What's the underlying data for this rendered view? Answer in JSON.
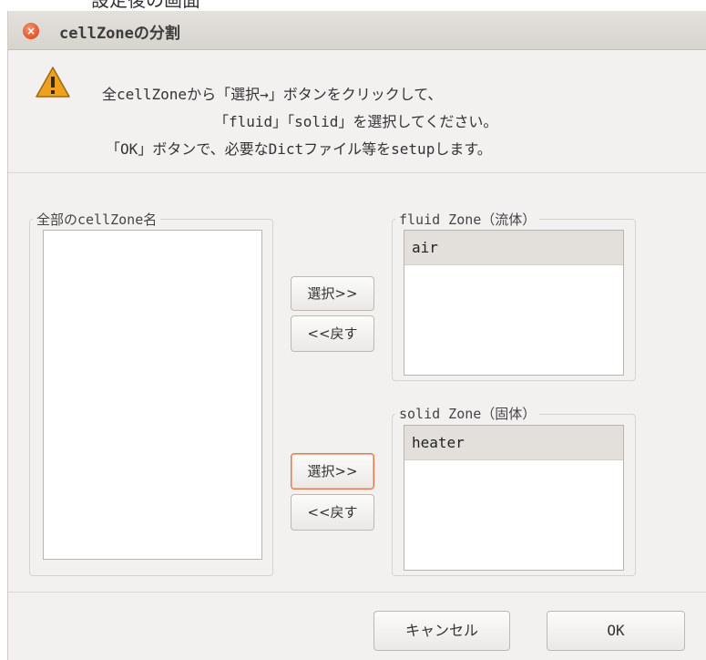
{
  "caption": "設定後の画面",
  "window": {
    "title": "cellZoneの分割"
  },
  "message": {
    "line1": "全cellZoneから「選択→」ボタンをクリックして、",
    "line2": "「fluid」「solid」を選択してください。",
    "line3": "「OK」ボタンで、必要なDictファイル等をsetupします。"
  },
  "all_zones": {
    "title": "全部のcellZone名",
    "items": []
  },
  "fluid": {
    "title": "fluid Zone（流体）",
    "items": [
      "air"
    ]
  },
  "solid": {
    "title": "solid Zone（固体）",
    "items": [
      "heater"
    ]
  },
  "buttons": {
    "select_fluid": "選択>>",
    "back_fluid": "<<戻す",
    "select_solid": "選択>>",
    "back_solid": "<<戻す",
    "cancel": "キャンセル",
    "ok": "OK"
  },
  "icons": {
    "close": "close-icon",
    "warning": "warning-icon"
  },
  "colors": {
    "close": "#e0552a",
    "warning_fill": "#f0a020",
    "focus": "#e0784f"
  }
}
